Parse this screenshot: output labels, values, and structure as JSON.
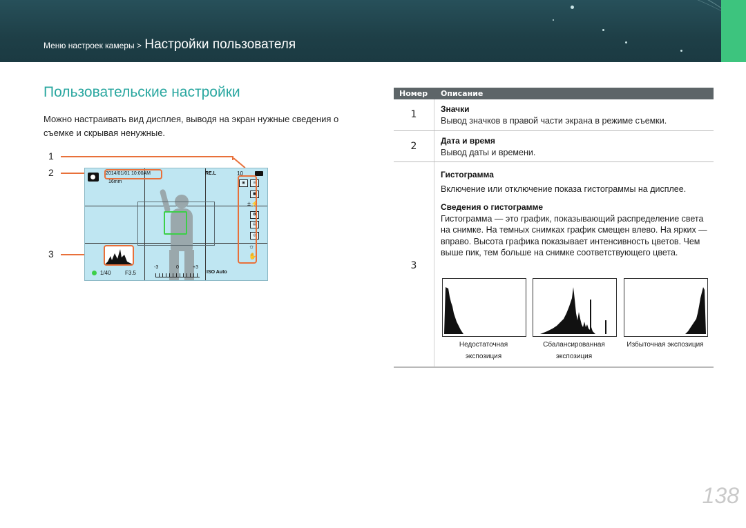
{
  "header": {
    "breadcrumb_small": "Меню настроек камеры >",
    "breadcrumb_big": "Настройки пользователя"
  },
  "page": {
    "title": "Пользовательские настройки",
    "intro": "Можно настраивать вид дисплея, выводя на экран нужные сведения о съемке и скрывая ненужные.",
    "page_number": "138"
  },
  "figure": {
    "callouts": [
      "1",
      "2",
      "3"
    ],
    "camera_screen": {
      "datetime": "2014/01/01 10:00AM",
      "size": "16mm",
      "shots": "10",
      "quality": "RE.L",
      "shutter": "1/40",
      "aperture": "F3.5",
      "ev_minus": "-3",
      "ev_zero": "0",
      "ev_plus": "+3",
      "iso": "ISO Auto"
    }
  },
  "table": {
    "headers": [
      "Номер",
      "Описание"
    ],
    "rows": [
      {
        "num": "1",
        "title": "Значки",
        "text": "Вывод значков в правой части экрана в режиме съемки."
      },
      {
        "num": "2",
        "title": "Дата и время",
        "text": "Вывод даты и времени."
      },
      {
        "num": "3",
        "title": "Гистограмма",
        "text": "Включение или отключение показа гистограммы на дисплее.",
        "subtitle": "Сведения о гистограмме",
        "subtext": "Гистограмма — это график, показывающий распределение света на снимке. На темных снимках график смещен влево. На ярких — вправо. Высота графика показывает интенсивность цветов. Чем выше пик, тем больше на снимке соответствующего цвета."
      }
    ]
  },
  "histograms": [
    {
      "label_line1": "Недостаточная",
      "label_line2": "экспозиция"
    },
    {
      "label_line1": "Сбалансированная",
      "label_line2": "экспозиция"
    },
    {
      "label_line1": "Избыточная экспозиция",
      "label_line2": ""
    }
  ],
  "colors": {
    "accent": "#2aa7a0",
    "header_bg": "#1e3f47",
    "tab_green": "#3dc47e",
    "callout_orange": "#e8703a",
    "screen_bg": "#bfe6f2",
    "table_header": "#5d6568"
  }
}
